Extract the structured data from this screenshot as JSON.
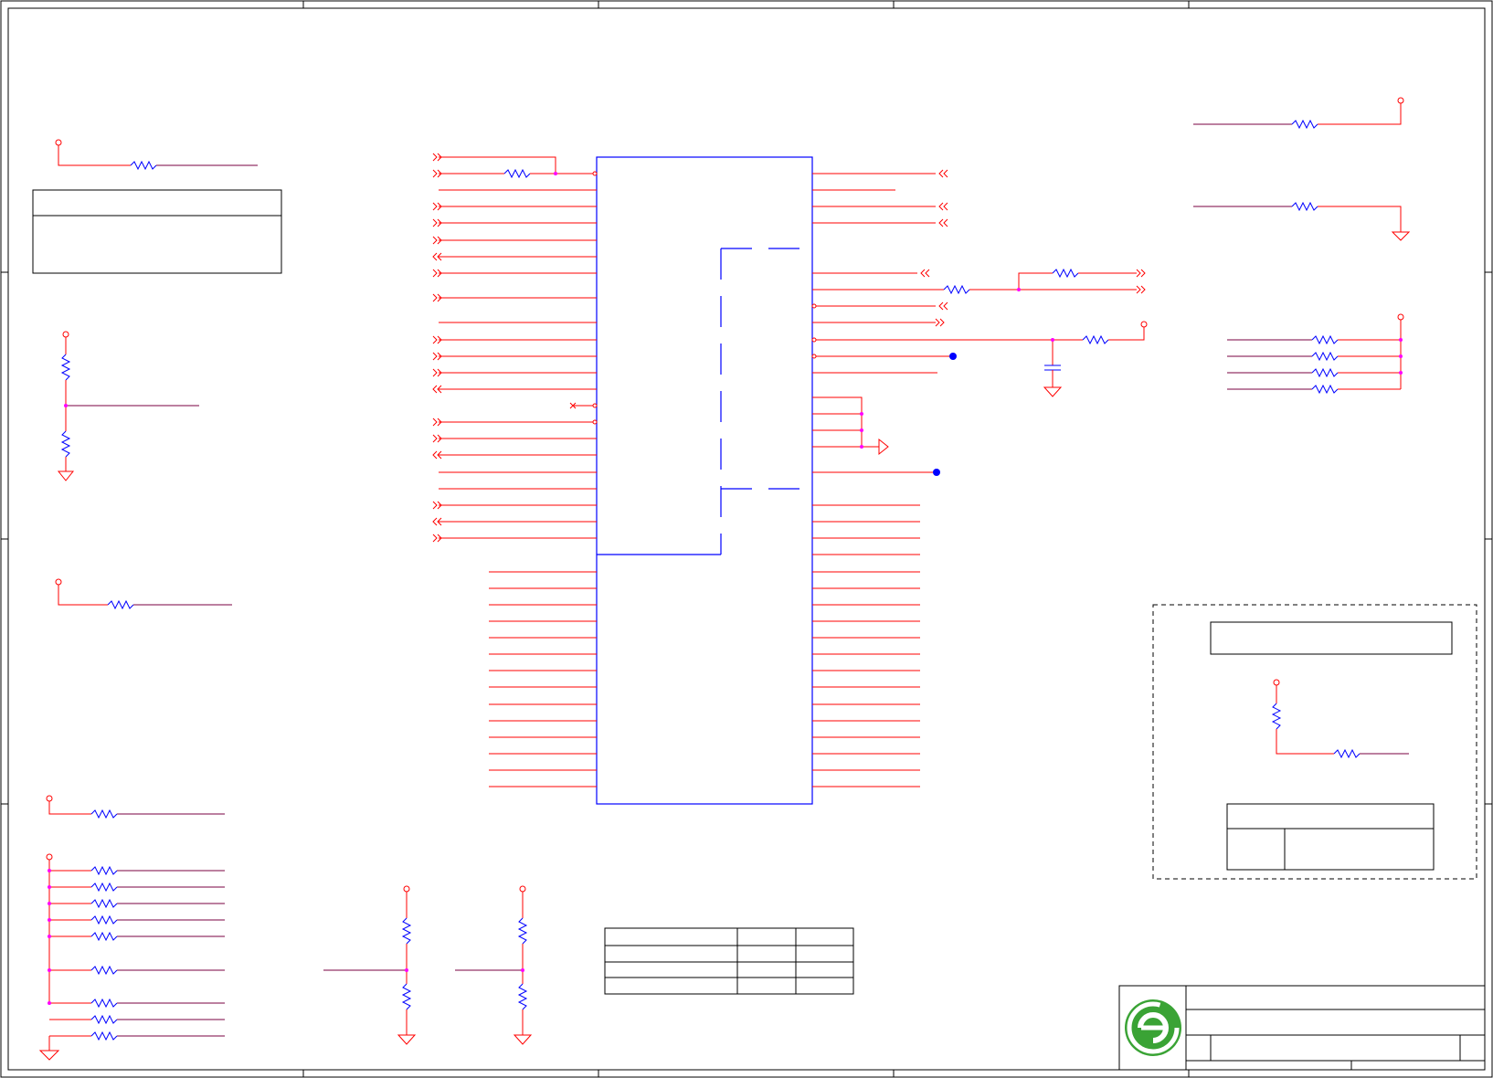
{
  "schematic": {
    "colors": {
      "wire": "#ff0000",
      "net": "#7a0040",
      "component": "#0000ff",
      "junction": "#ff00ff",
      "frame": "#000000",
      "logo_green": "#3aa335"
    },
    "icons": [
      "resistor-icon",
      "capacitor-icon",
      "ground-icon",
      "power-pin-icon",
      "port-arrow-icon",
      "no-connect-icon",
      "company-logo-icon"
    ]
  }
}
